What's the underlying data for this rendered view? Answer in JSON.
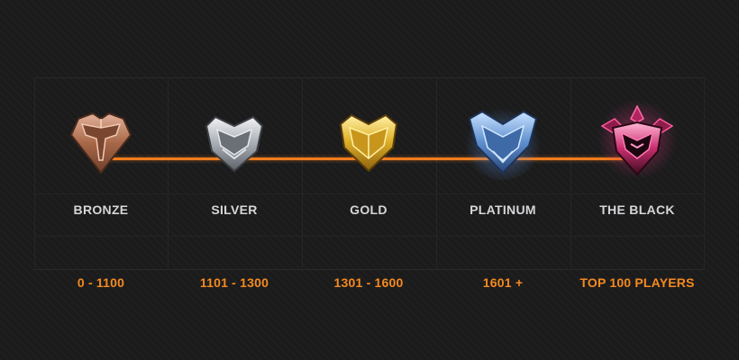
{
  "colors": {
    "accent": "#f07d1e",
    "bronze": "#b9785a",
    "silver": "#b8bcc2",
    "gold": "#e6b92c",
    "platinum": "#6f9ed6",
    "black": "#e0357c"
  },
  "tiers": [
    {
      "name": "BRONZE",
      "range": "0 - 1100",
      "icon": "bronze-rank-icon"
    },
    {
      "name": "SILVER",
      "range": "1101 - 1300",
      "icon": "silver-rank-icon"
    },
    {
      "name": "GOLD",
      "range": "1301 - 1600",
      "icon": "gold-rank-icon"
    },
    {
      "name": "PLATINUM",
      "range": "1601 +",
      "icon": "platinum-rank-icon"
    },
    {
      "name": "THE BLACK",
      "range": "TOP 100 PLAYERS",
      "icon": "the-black-rank-icon"
    }
  ]
}
